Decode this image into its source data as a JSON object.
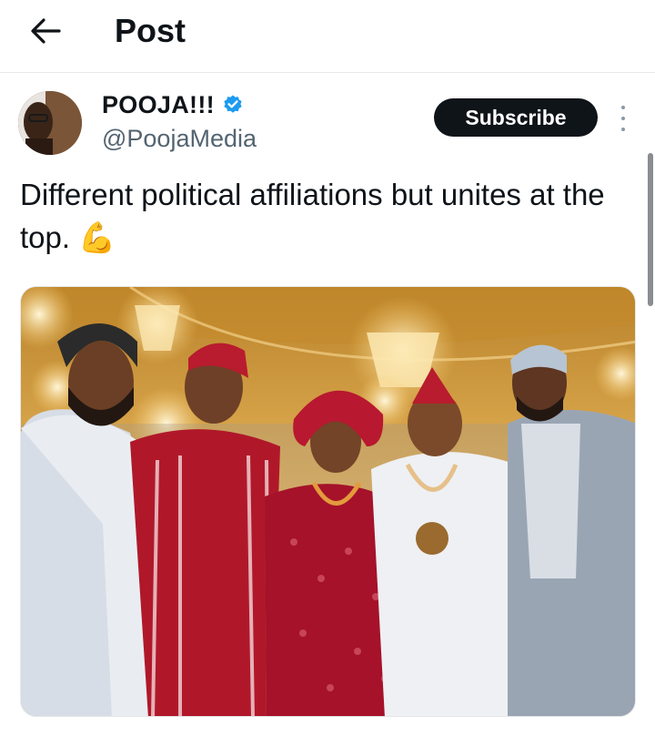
{
  "header": {
    "title": "Post",
    "back_icon": "arrow-left-icon"
  },
  "post": {
    "author": {
      "name": "POOJA!!!",
      "handle": "@PoojaMedia",
      "verified": true,
      "verified_icon": "verified-badge-icon",
      "verified_color": "#1d9bf0"
    },
    "subscribe_label": "Subscribe",
    "more_icon": "more-vertical-icon",
    "text": "Different political affiliations but unites at the top. 💪",
    "media": {
      "kind": "photo",
      "subject": "five people posing at an indoor event with chandeliers"
    }
  },
  "colors": {
    "text_primary": "#0f1419",
    "text_secondary": "#536471",
    "button_bg": "#0f1419",
    "divider": "#e6e9ec"
  }
}
